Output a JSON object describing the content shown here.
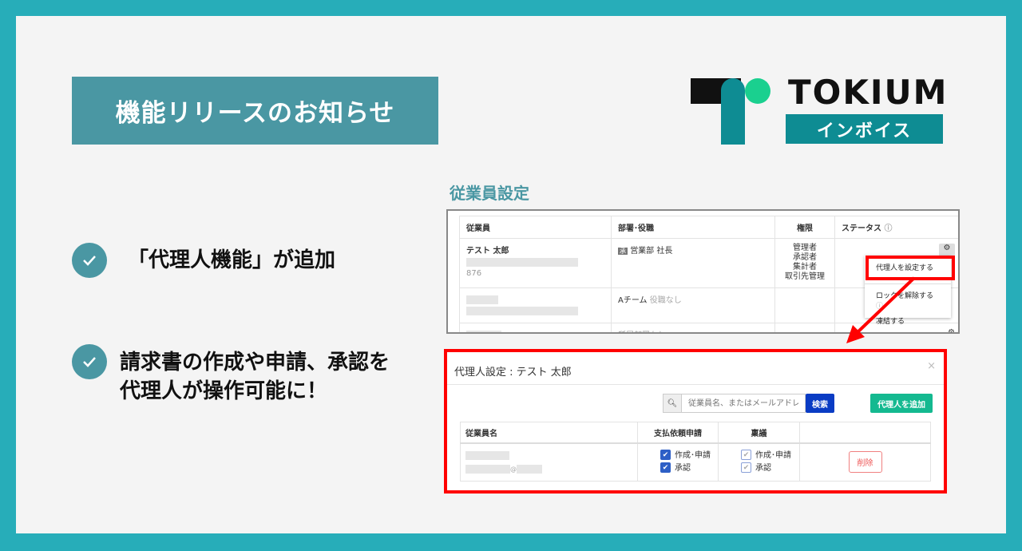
{
  "title": "機能リリースのお知らせ",
  "logo": {
    "brand": "TOKIUM",
    "product": "インボイス"
  },
  "features": [
    {
      "text": "「代理人機能」が追加"
    },
    {
      "line1": "請求書の作成や申請、承認を",
      "line2": "代理人が操作可能に！"
    }
  ],
  "section_title": "従業員設定",
  "employee_table": {
    "headers": [
      "従業員",
      "部署･役職",
      "権限",
      "ステータス"
    ],
    "rows": [
      {
        "name": "テスト 太郎",
        "id": "876",
        "dept_badge": "承",
        "dept": "営業部 社長",
        "roles": [
          "管理者",
          "承認者",
          "集計者",
          "取引先管理"
        ]
      },
      {
        "dept": "Aチーム",
        "role_note": "役職なし"
      },
      {
        "dept_note": "所属部署なし"
      }
    ]
  },
  "menu": {
    "items": [
      "代理人を設定する",
      "ロックを解除する",
      "凍結する"
    ]
  },
  "modal": {
    "title": "代理人設定 : テスト 太郎",
    "close": "×",
    "search_placeholder": "従業員名、またはメールアドレス",
    "search_button": "検索",
    "add_button": "代理人を追加",
    "headers": [
      "従業員名",
      "支払依頼申請",
      "稟議",
      ""
    ],
    "row": {
      "email_at": "@",
      "payment": [
        "作成･申請",
        "承認"
      ],
      "ringi": [
        "作成･申請",
        "承認"
      ],
      "delete": "削除"
    }
  },
  "colors": {
    "frame": "#27adb9",
    "accent": "#4a97a3",
    "highlight": "#ff0000",
    "primary": "#0a3cc4",
    "green": "#14b990"
  }
}
